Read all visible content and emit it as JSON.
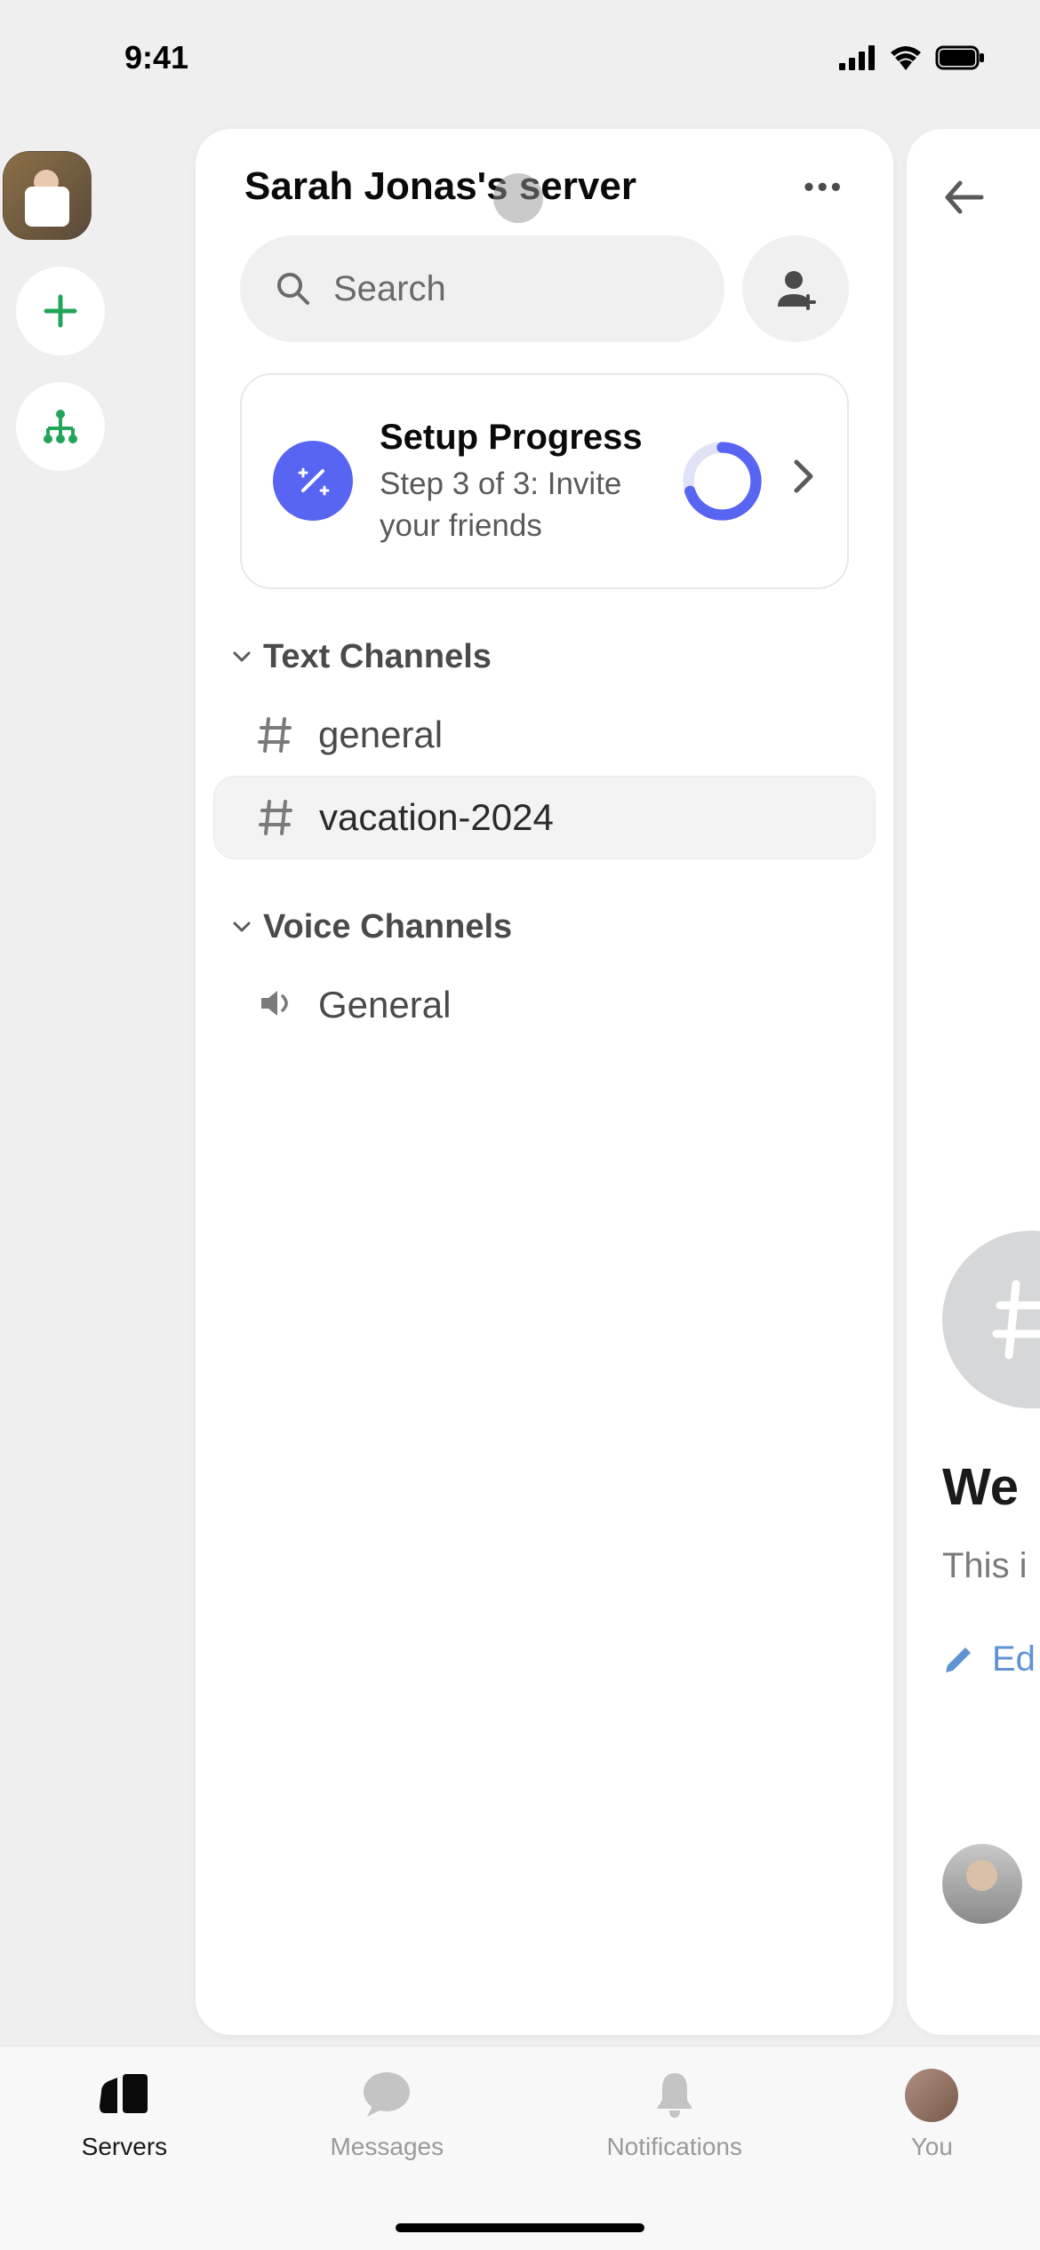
{
  "status": {
    "time": "9:41"
  },
  "header": {
    "title": "Sarah Jonas's server",
    "more_label": "•••"
  },
  "search": {
    "placeholder": "Search"
  },
  "setup": {
    "title": "Setup Progress",
    "subtitle": "Step 3 of 3: Invite your friends",
    "progress_percent": 70
  },
  "sections": {
    "text": {
      "title": "Text Channels",
      "channels": [
        {
          "name": "general",
          "selected": false
        },
        {
          "name": "vacation-2024",
          "selected": true
        }
      ]
    },
    "voice": {
      "title": "Voice Channels",
      "channels": [
        {
          "name": "General"
        }
      ]
    }
  },
  "peek": {
    "welcome": "We",
    "subtitle": "This i",
    "edit": "Ed"
  },
  "nav": {
    "servers": "Servers",
    "messages": "Messages",
    "notifications": "Notifications",
    "you": "You"
  }
}
